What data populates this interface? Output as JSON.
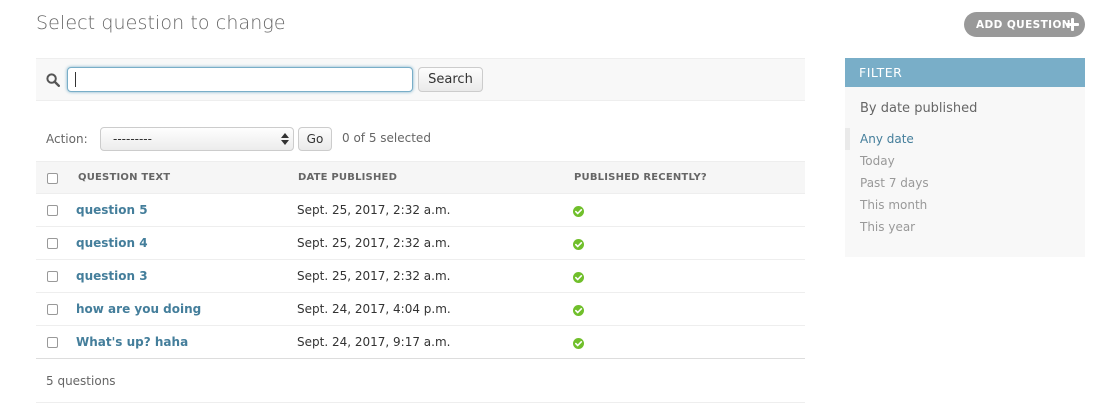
{
  "page": {
    "title": "Select question to change"
  },
  "header": {
    "add_button_label": "ADD QUESTION"
  },
  "search": {
    "value": "",
    "button_label": "Search"
  },
  "actions": {
    "label": "Action:",
    "selected_option": "---------",
    "go_label": "Go",
    "selection_counter": "0 of 5 selected"
  },
  "table": {
    "columns": [
      "QUESTION TEXT",
      "DATE PUBLISHED",
      "PUBLISHED RECENTLY?"
    ],
    "rows": [
      {
        "question_text": "question 5",
        "date_published": "Sept. 25, 2017, 2:32 a.m.",
        "published_recently": true
      },
      {
        "question_text": "question 4",
        "date_published": "Sept. 25, 2017, 2:32 a.m.",
        "published_recently": true
      },
      {
        "question_text": "question 3",
        "date_published": "Sept. 25, 2017, 2:32 a.m.",
        "published_recently": true
      },
      {
        "question_text": "how are you doing",
        "date_published": "Sept. 24, 2017, 4:04 p.m.",
        "published_recently": true
      },
      {
        "question_text": "What's up? haha",
        "date_published": "Sept. 24, 2017, 9:17 a.m.",
        "published_recently": true
      }
    ]
  },
  "paginator": {
    "count_text": "5 questions"
  },
  "filter": {
    "title": "FILTER",
    "section_title": "By date published",
    "options": [
      "Any date",
      "Today",
      "Past 7 days",
      "This month",
      "This year"
    ],
    "selected": "Any date"
  },
  "icons": {
    "search": "search-icon",
    "add": "plus-icon",
    "published": "check-circle-icon",
    "select": "select-arrows-icon"
  },
  "colors": {
    "accent": "#79aec8",
    "link": "#447e9b",
    "success": "#70bf2b",
    "button_gray": "#999999"
  }
}
